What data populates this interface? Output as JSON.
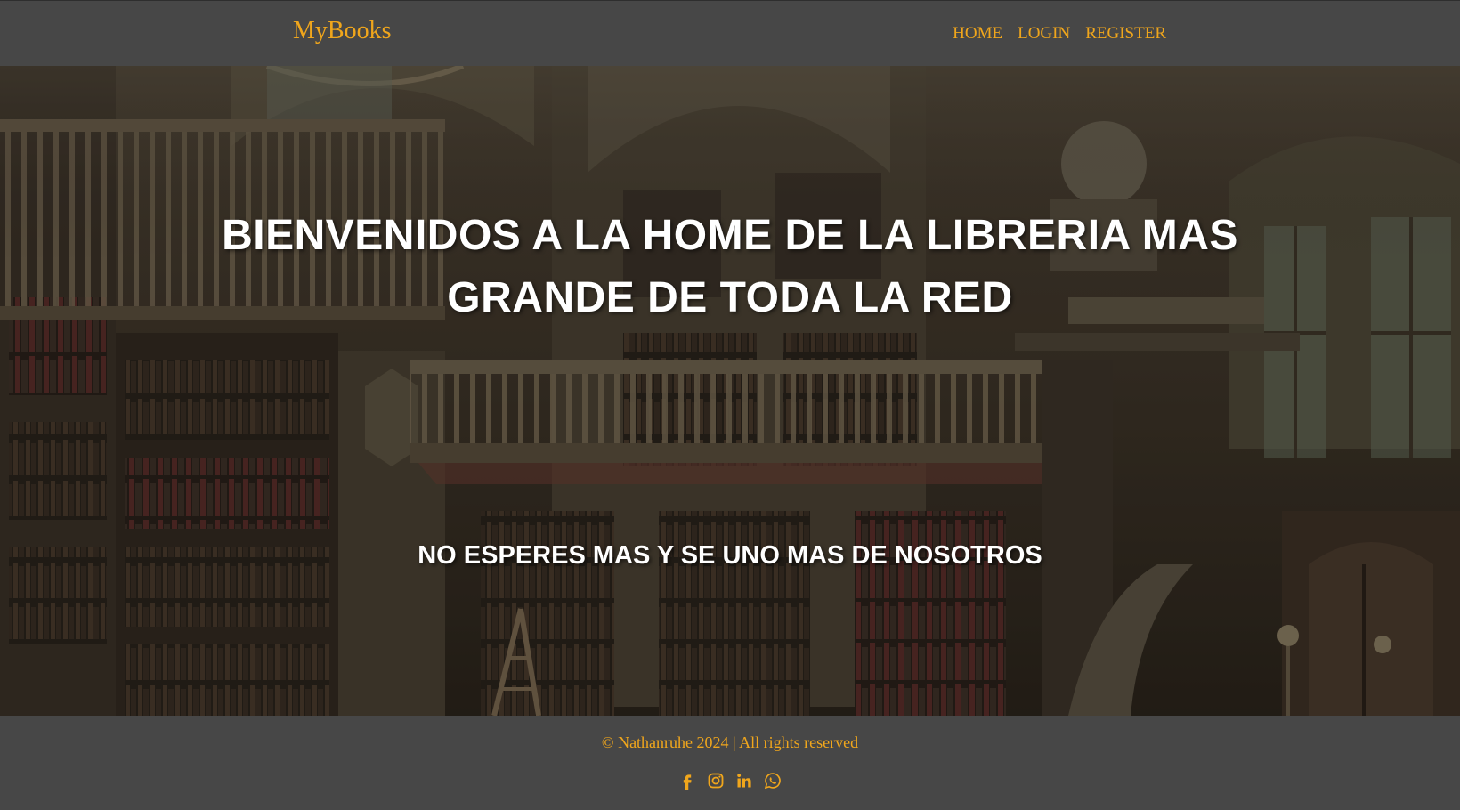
{
  "navbar": {
    "brand": "MyBooks",
    "links": [
      {
        "label": "HOME"
      },
      {
        "label": "LOGIN"
      },
      {
        "label": "REGISTER"
      }
    ]
  },
  "hero": {
    "title": "BIENVENIDOS A LA HOME DE LA LIBRERIA MAS GRANDE DE TODA LA RED",
    "subtitle": "NO ESPERES MAS Y SE UNO MAS DE NOSOTROS",
    "background": "library-illustration"
  },
  "footer": {
    "copyright": "© Nathanruhe 2024 | All rights reserved",
    "socials": [
      {
        "icon": "facebook-icon"
      },
      {
        "icon": "instagram-icon"
      },
      {
        "icon": "linkedin-icon"
      },
      {
        "icon": "whatsapp-icon"
      }
    ]
  },
  "colors": {
    "accent": "#f0a61c",
    "bar_background": "#474747",
    "text_on_hero": "#ffffff"
  }
}
